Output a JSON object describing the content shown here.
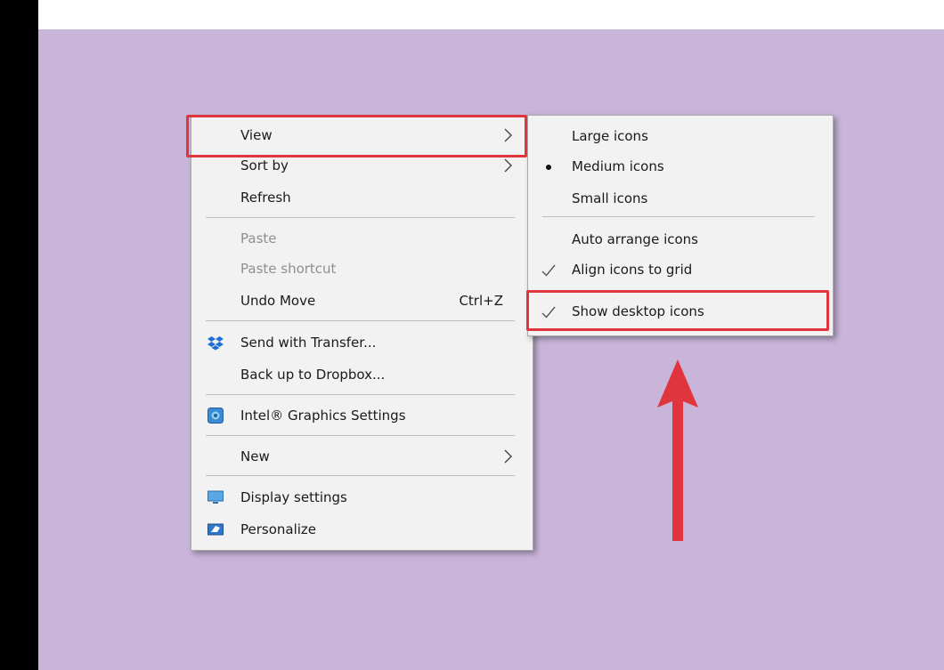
{
  "context_menu": {
    "items": [
      {
        "label": "View",
        "has_submenu": true
      },
      {
        "label": "Sort by",
        "has_submenu": true
      },
      {
        "label": "Refresh"
      },
      {
        "label": "Paste",
        "disabled": true
      },
      {
        "label": "Paste shortcut",
        "disabled": true
      },
      {
        "label": "Undo Move",
        "shortcut": "Ctrl+Z"
      },
      {
        "label": "Send with Transfer...",
        "icon": "dropbox-icon"
      },
      {
        "label": "Back up to Dropbox..."
      },
      {
        "label": "Intel® Graphics Settings",
        "icon": "intel-graphics-icon"
      },
      {
        "label": "New",
        "has_submenu": true
      },
      {
        "label": "Display settings",
        "icon": "monitor-icon"
      },
      {
        "label": "Personalize",
        "icon": "personalize-icon"
      }
    ]
  },
  "view_submenu": {
    "items": [
      {
        "label": "Large icons"
      },
      {
        "label": "Medium icons",
        "selected": true,
        "marker": "bullet"
      },
      {
        "label": "Small icons"
      },
      {
        "label": "Auto arrange icons"
      },
      {
        "label": "Align icons to grid",
        "checked": true,
        "marker": "check"
      },
      {
        "label": "Show desktop icons",
        "checked": true,
        "marker": "check"
      }
    ]
  },
  "colors": {
    "desktop": "#c8b5d9",
    "menu": "#f2f2f2",
    "highlight": "#e0353d",
    "arrow": "#e0353d"
  }
}
